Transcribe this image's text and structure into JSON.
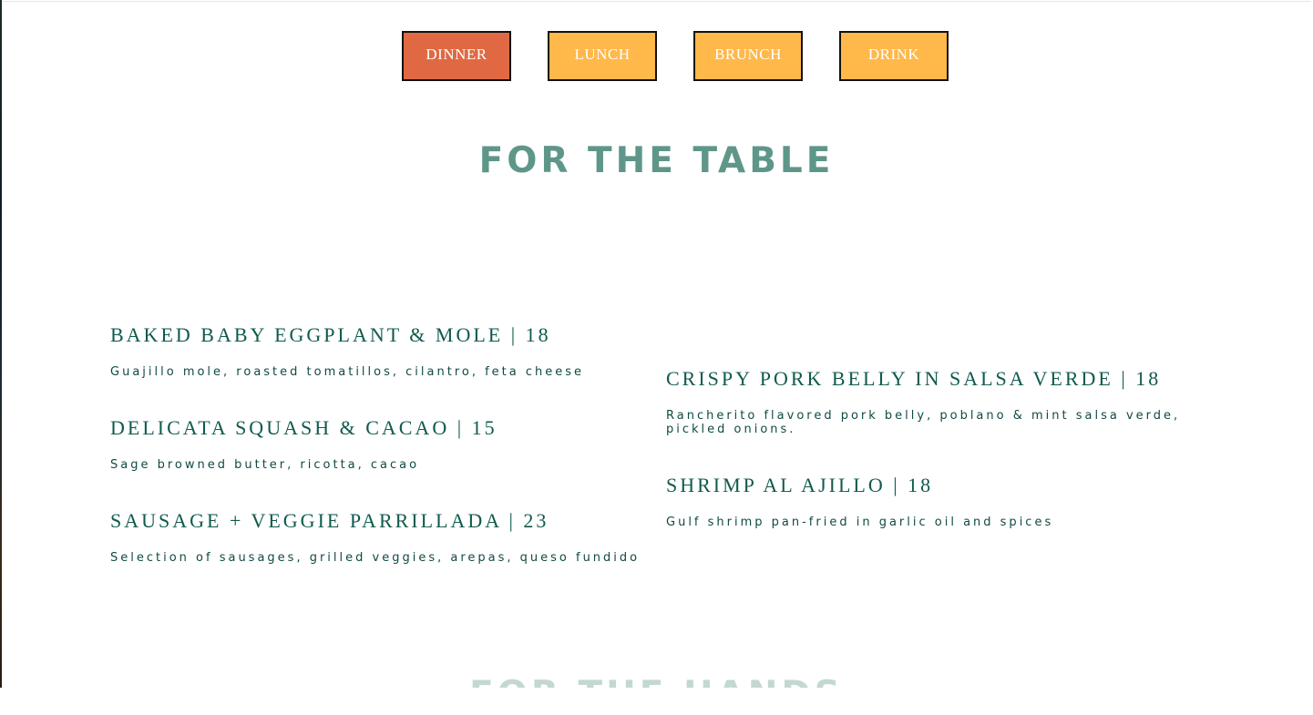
{
  "tabs": [
    {
      "label": "DINNER",
      "active": true
    },
    {
      "label": "LUNCH",
      "active": false
    },
    {
      "label": "BRUNCH",
      "active": false
    },
    {
      "label": "DRINK",
      "active": false
    }
  ],
  "section": {
    "title": "FOR THE TABLE",
    "left_items": [
      {
        "name": "BAKED BABY EGGPLANT & MOLE | 18",
        "description": "Guajillo mole, roasted tomatillos, cilantro, feta cheese"
      },
      {
        "name": "DELICATA SQUASH & CACAO | 15",
        "description": "Sage browned butter, ricotta, cacao"
      },
      {
        "name": "SAUSAGE + VEGGIE PARRILLADA | 23",
        "description": "Selection of sausages, grilled veggies, arepas, queso fundido"
      }
    ],
    "right_items": [
      {
        "name": "CRISPY PORK BELLY IN SALSA VERDE | 18",
        "description": "Rancherito flavored pork belly, poblano & mint salsa verde, pickled onions."
      },
      {
        "name": "SHRIMP AL AJILLO | 18",
        "description": "Gulf shrimp pan-fried in garlic oil and spices"
      }
    ]
  },
  "next_section": {
    "title": "FOR THE HANDS"
  },
  "colors": {
    "tab_active": "#e06943",
    "tab_inactive": "#ffb84a",
    "title": "#5e968a",
    "item_text": "#0f5a4e"
  }
}
